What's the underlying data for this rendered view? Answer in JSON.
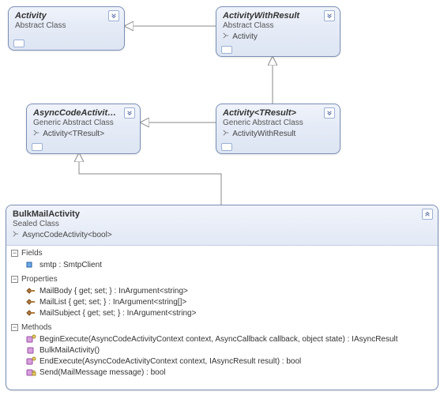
{
  "activity": {
    "title": "Activity",
    "stereotype": "Abstract Class"
  },
  "activityWithResult": {
    "title": "ActivityWithResult",
    "stereotype": "Abstract Class",
    "inherit": "Activity"
  },
  "asyncCodeActivity": {
    "title": "AsyncCodeActivit…",
    "stereotype": "Generic Abstract Class",
    "inherit": "Activity<TResult>"
  },
  "activityTResult": {
    "title": "Activity<TResult>",
    "stereotype": "Generic Abstract Class",
    "inherit": "ActivityWithResult"
  },
  "bulkMail": {
    "title": "BulkMailActivity",
    "stereotype": "Sealed Class",
    "inherit": "AsyncCodeActivity<bool>",
    "sections": {
      "fields": {
        "label": "Fields",
        "items": [
          {
            "icon": "field",
            "text": "smtp : SmtpClient"
          }
        ]
      },
      "properties": {
        "label": "Properties",
        "items": [
          {
            "icon": "property",
            "text": "MailBody { get; set; } : InArgument<string>"
          },
          {
            "icon": "property",
            "text": "MailList { get; set; } : InArgument<string[]>"
          },
          {
            "icon": "property",
            "text": "MailSubject { get; set; } : InArgument<string>"
          }
        ]
      },
      "methods": {
        "label": "Methods",
        "items": [
          {
            "icon": "method-override",
            "text": "BeginExecute(AsyncCodeActivityContext context, AsyncCallback callback, object state) : IAsyncResult"
          },
          {
            "icon": "method",
            "text": "BulkMailActivity()"
          },
          {
            "icon": "method-override",
            "text": "EndExecute(AsyncCodeActivityContext context, IAsyncResult result) : bool"
          },
          {
            "icon": "method-private",
            "text": "Send(MailMessage message) : bool"
          }
        ]
      }
    }
  }
}
